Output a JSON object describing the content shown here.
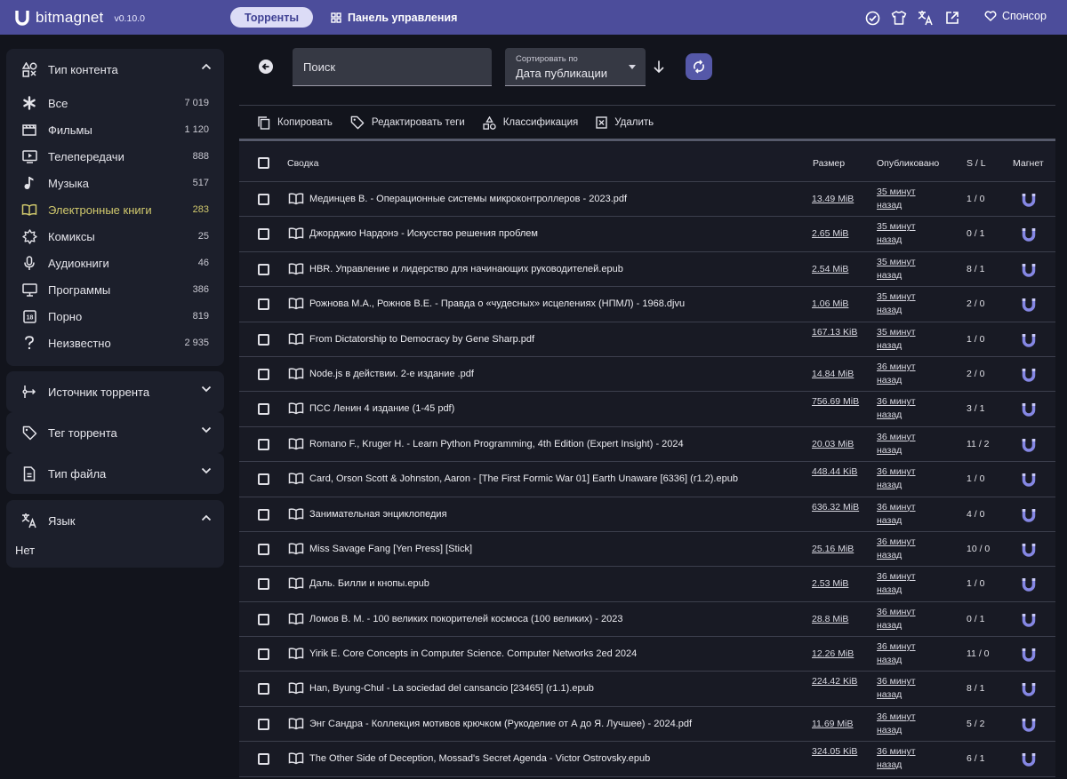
{
  "app": {
    "name": "bitmagnet",
    "version": "v0.10.0"
  },
  "nav": {
    "torrents": "Торренты",
    "dashboard": "Панель управления",
    "sponsor": "Спонсор"
  },
  "sidebar": {
    "content_type": {
      "title": "Тип контента",
      "items": [
        {
          "label": "Все",
          "count": "7 019",
          "icon": "asterisk-icon"
        },
        {
          "label": "Фильмы",
          "count": "1 120",
          "icon": "movie-icon"
        },
        {
          "label": "Телепередачи",
          "count": "888",
          "icon": "tv-icon"
        },
        {
          "label": "Музыка",
          "count": "517",
          "icon": "music-note-icon"
        },
        {
          "label": "Электронные книги",
          "count": "283",
          "icon": "book-icon"
        },
        {
          "label": "Комиксы",
          "count": "25",
          "icon": "comic-icon"
        },
        {
          "label": "Аудиокниги",
          "count": "46",
          "icon": "microphone-icon"
        },
        {
          "label": "Программы",
          "count": "386",
          "icon": "monitor-icon"
        },
        {
          "label": "Порно",
          "count": "819",
          "icon": "adult-18-icon"
        },
        {
          "label": "Неизвестно",
          "count": "2 935",
          "icon": "question-icon"
        }
      ]
    },
    "torrent_source": {
      "title": "Источник торрента"
    },
    "torrent_tag": {
      "title": "Тег торрента"
    },
    "file_type": {
      "title": "Тип файла"
    },
    "language": {
      "title": "Язык",
      "value": "Нет"
    }
  },
  "search": {
    "placeholder": "Поиск"
  },
  "sort": {
    "label": "Сортировать по",
    "value": "Дата публикации"
  },
  "actions": {
    "copy": "Копировать",
    "edit_tags": "Редактировать теги",
    "classify": "Классификация",
    "delete": "Удалить"
  },
  "table": {
    "headers": {
      "summary": "Сводка",
      "size": "Размер",
      "published": "Опубликовано",
      "sl": "S / L",
      "magnet": "Магнет"
    },
    "rows": [
      {
        "title": "Мединцев В. - Операционные системы микроконтроллеров - 2023.pdf",
        "size": "13.49 MiB",
        "published": "35 минут назад",
        "sl": "1 / 0"
      },
      {
        "title": "Джорджио Нардонэ - Искусство решения проблем",
        "size": "2.65 MiB",
        "published": "35 минут назад",
        "sl": "0 / 1"
      },
      {
        "title": "HBR. Управление и лидерство для начинающих руководителей.epub",
        "size": "2.54 MiB",
        "published": "35 минут назад",
        "sl": "8 / 1"
      },
      {
        "title": "Рожнова М.А., Рожнов В.Е. - Правда о «чудесных» исцелениях (НПМЛ) - 1968.djvu",
        "size": "1.06 MiB",
        "published": "35 минут назад",
        "sl": "2 / 0"
      },
      {
        "title": "From Dictatorship to Democracy by Gene Sharp.pdf",
        "size": "167.13 KiB",
        "published": "35 минут назад",
        "sl": "1 / 0"
      },
      {
        "title": "Node.js в действии. 2-е издание .pdf",
        "size": "14.84 MiB",
        "published": "36 минут назад",
        "sl": "2 / 0"
      },
      {
        "title": "ПСС Ленин 4 издание (1-45 pdf)",
        "size": "756.69 MiB",
        "published": "36 минут назад",
        "sl": "3 / 1"
      },
      {
        "title": "Romano F., Kruger H. - Learn Python Programming, 4th Edition (Expert Insight) - 2024",
        "size": "20.03 MiB",
        "published": "36 минут назад",
        "sl": "11 / 2"
      },
      {
        "title": "Card, Orson Scott & Johnston, Aaron - [The First Formic War 01] Earth Unaware [6336] (r1.2).epub",
        "size": "448.44 KiB",
        "published": "36 минут назад",
        "sl": "1 / 0"
      },
      {
        "title": "Занимательная энциклопедия",
        "size": "636.32 MiB",
        "published": "36 минут назад",
        "sl": "4 / 0"
      },
      {
        "title": "Miss Savage Fang [Yen Press] [Stick]",
        "size": "25.16 MiB",
        "published": "36 минут назад",
        "sl": "10 / 0"
      },
      {
        "title": "Даль. Билли и кнопы.epub",
        "size": "2.53 MiB",
        "published": "36 минут назад",
        "sl": "1 / 0"
      },
      {
        "title": "Ломов В. М. - 100 великих покорителей космоса (100 великих) - 2023",
        "size": "28.8 MiB",
        "published": "36 минут назад",
        "sl": "0 / 1"
      },
      {
        "title": "Yirik E. Core Concepts in Computer Science. Computer Networks 2ed 2024",
        "size": "12.26 MiB",
        "published": "36 минут назад",
        "sl": "11 / 0"
      },
      {
        "title": "Han, Byung-Chul - La sociedad del cansancio [23465] (r1.1).epub",
        "size": "224.42 KiB",
        "published": "36 минут назад",
        "sl": "8 / 1"
      },
      {
        "title": "Энг Сандра - Коллекция мотивов крючком (Рукоделие от А до Я. Лучшее) - 2024.pdf",
        "size": "11.69 MiB",
        "published": "36 минут назад",
        "sl": "5 / 2"
      },
      {
        "title": "The Other Side of Deception, Mossad's Secret Agenda - Victor Ostrovsky.epub",
        "size": "324.05 KiB",
        "published": "36 минут назад",
        "sl": "6 / 1"
      }
    ]
  },
  "colors": {
    "accent": "#4c4d9b",
    "active_category": "#d1c96d",
    "background": "#12141c",
    "panel": "#1c1f2b"
  }
}
